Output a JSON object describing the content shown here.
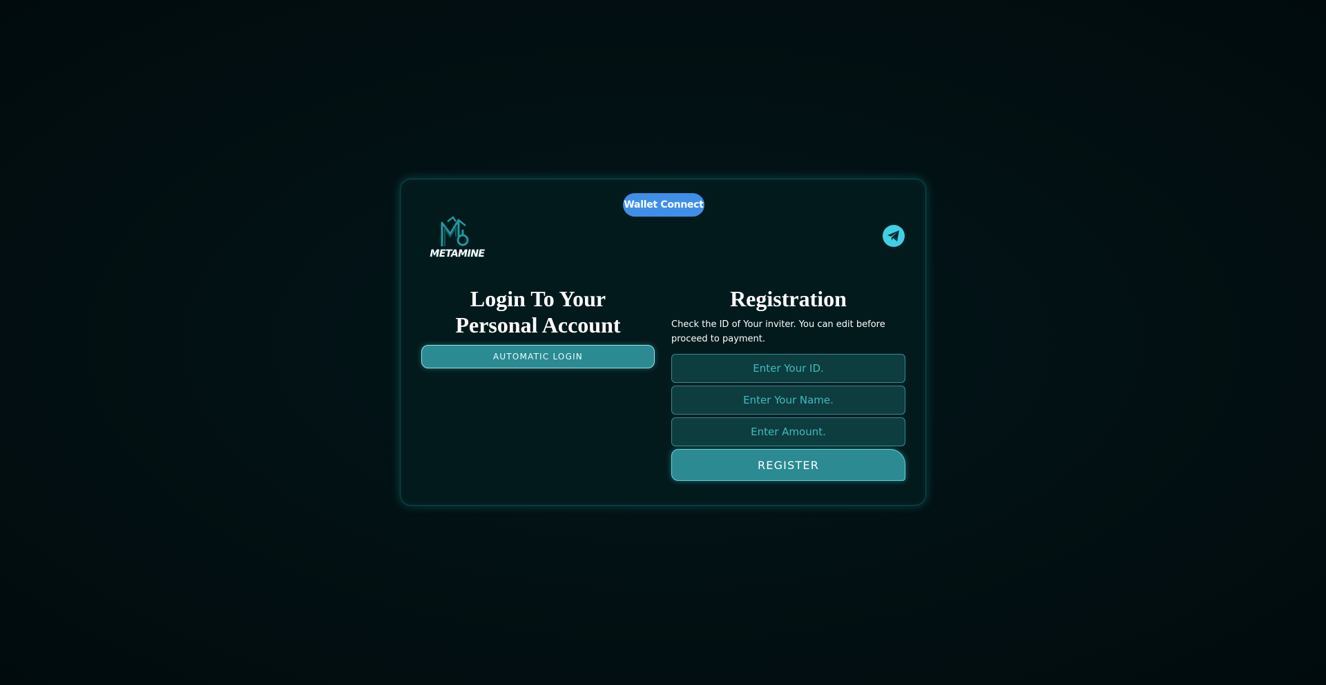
{
  "header": {
    "wallet_connect_label": "Wallet Connect",
    "logo_text": "METAMINE",
    "logo_icon": "metamine-logo-icon",
    "social_icon": "telegram-icon"
  },
  "login": {
    "title_line1": "Login To Your",
    "title_line2": "Personal Account",
    "automatic_login_label": "AUTOMATIC LOGIN"
  },
  "registration": {
    "title": "Registration",
    "description": "Check the ID of Your inviter. You can edit before proceed to payment.",
    "id_field": {
      "placeholder": "Enter Your ID.",
      "value": ""
    },
    "name_field": {
      "placeholder": "Enter Your Name.",
      "value": ""
    },
    "amount_field": {
      "placeholder": "Enter Amount.",
      "value": ""
    },
    "register_label": "REGISTER"
  },
  "colors": {
    "background": "#020f12",
    "card": "#031a1d",
    "accent_teal": "#2b8a92",
    "wallet_blue": "#3f8fe8",
    "telegram_cyan": "#3fd0e4",
    "input_bg": "#0d3d3f",
    "input_text": "#43c2c6"
  }
}
